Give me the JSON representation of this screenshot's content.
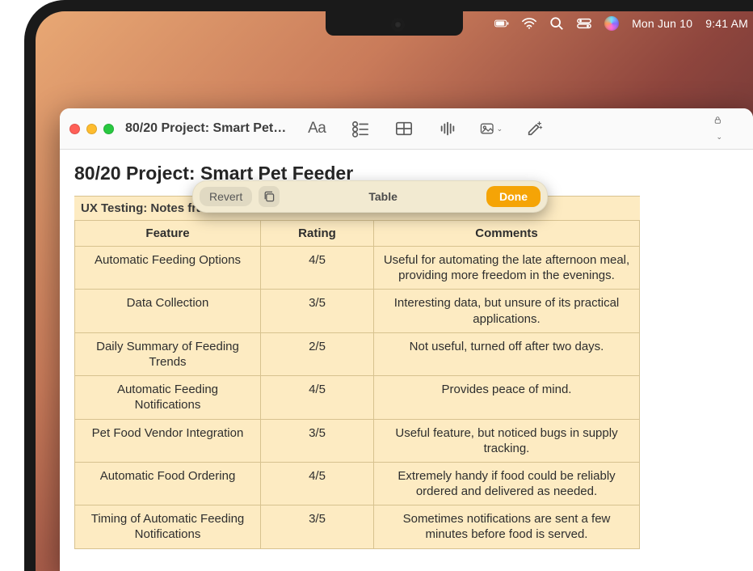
{
  "menubar": {
    "date": "Mon Jun 10",
    "time": "9:41 AM"
  },
  "window": {
    "title": "80/20 Project: Smart Pet…"
  },
  "doc": {
    "title": "80/20 Project: Smart Pet Feeder",
    "subhead": "UX Testing: Notes fra"
  },
  "pill": {
    "revert": "Revert",
    "label": "Table",
    "done": "Done"
  },
  "table": {
    "headers": {
      "feature": "Feature",
      "rating": "Rating",
      "comments": "Comments"
    },
    "rows": [
      {
        "feature": "Automatic Feeding Options",
        "rating": "4/5",
        "comments": "Useful for automating the late afternoon meal, providing more freedom in the evenings."
      },
      {
        "feature": "Data Collection",
        "rating": "3/5",
        "comments": "Interesting data, but unsure of its practical applications."
      },
      {
        "feature": "Daily Summary of Feeding Trends",
        "rating": "2/5",
        "comments": "Not useful, turned off after two days."
      },
      {
        "feature": "Automatic Feeding Notifications",
        "rating": "4/5",
        "comments": "Provides peace of mind."
      },
      {
        "feature": "Pet Food Vendor Integration",
        "rating": "3/5",
        "comments": "Useful feature, but noticed bugs in supply tracking."
      },
      {
        "feature": "Automatic Food Ordering",
        "rating": "4/5",
        "comments": "Extremely handy if food could be reliably ordered and delivered as needed."
      },
      {
        "feature": "Timing of Automatic Feeding Notifications",
        "rating": "3/5",
        "comments": "Sometimes notifications are sent a few minutes before food is served."
      }
    ]
  }
}
